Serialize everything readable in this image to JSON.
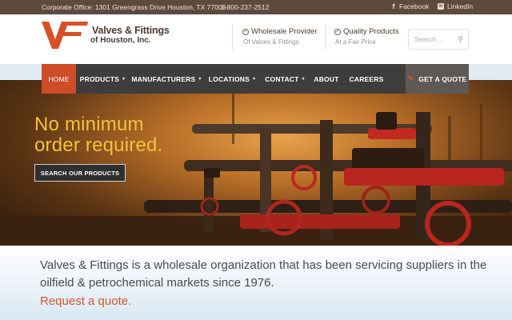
{
  "topbar": {
    "address": "Corporate Office: 1301 Greengrass Drive Houston, TX 77008",
    "phone": "1-800-237-2512",
    "facebook": "Facebook",
    "linkedin": "LinkedIn"
  },
  "header": {
    "brand_line1": "Valves & Fittings",
    "brand_line2": "of Houston, Inc.",
    "features": [
      {
        "title": "Wholesale Provider",
        "subtitle": "Of Valves & Fittings"
      },
      {
        "title": "Quality Products",
        "subtitle": "At a Fair Price"
      }
    ],
    "search_placeholder": "Search ..."
  },
  "nav": {
    "items": [
      {
        "label": "HOME",
        "active": true,
        "dropdown": false
      },
      {
        "label": "PRODUCTS",
        "dropdown": true
      },
      {
        "label": "MANUFACTURERS",
        "dropdown": true
      },
      {
        "label": "LOCATIONS",
        "dropdown": true
      },
      {
        "label": "CONTACT",
        "dropdown": true
      },
      {
        "label": "ABOUT",
        "dropdown": false
      },
      {
        "label": "CAREERS",
        "dropdown": false
      }
    ],
    "cta": "GET A QUOTE"
  },
  "hero": {
    "headline_line1": "No minimum",
    "headline_line2": "order required.",
    "button": "SEARCH OUR PRODUCTS"
  },
  "intro": {
    "text": "Valves & Fittings is a wholesale organization that has been servicing suppliers in the oilfield & petrochemical markets since 1976.",
    "link": "Request a quote."
  },
  "colors": {
    "accent": "#cf4c28",
    "topbar": "#5e4a3d",
    "nav": "#3f3d3b",
    "headline": "#f2c23a"
  }
}
